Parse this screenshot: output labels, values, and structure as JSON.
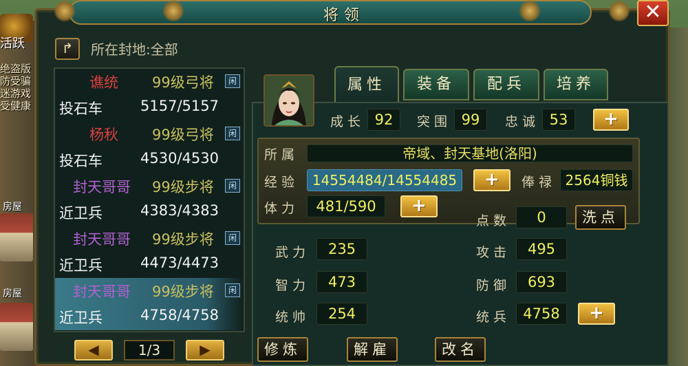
{
  "window": {
    "title": "将领",
    "close_label": "✕"
  },
  "fief": {
    "label": "所在封地:全部"
  },
  "left_side": {
    "tag": "活跃",
    "promo_lines": [
      "绝盗版",
      "防受骗",
      "迷游戏",
      "受健康"
    ],
    "houses": [
      "房屋",
      "房屋"
    ]
  },
  "generals": [
    {
      "name": "谯统",
      "name_color": "#d84040",
      "level": "99级弓将",
      "tag": "闲",
      "troop": "投石车",
      "count": "5157/5157"
    },
    {
      "name": "杨秋",
      "name_color": "#d84040",
      "level": "99级弓将",
      "tag": "闲",
      "troop": "投石车",
      "count": "4530/4530"
    },
    {
      "name": "封天哥哥",
      "name_color": "#b060d0",
      "level": "99级步将",
      "tag": "闲",
      "troop": "近卫兵",
      "count": "4383/4383"
    },
    {
      "name": "封天哥哥",
      "name_color": "#b060d0",
      "level": "99级步将",
      "tag": "闲",
      "troop": "近卫兵",
      "count": "4473/4473"
    },
    {
      "name": "封天哥哥",
      "name_color": "#b060d0",
      "level": "99级步将",
      "tag": "闲",
      "troop": "近卫兵",
      "count": "4758/4758"
    }
  ],
  "pagination": {
    "prev": "◀",
    "page": "1/3",
    "next": "▶"
  },
  "tabs": [
    "属性",
    "装备",
    "配兵",
    "培养"
  ],
  "top_stats": {
    "growth_label": "成长",
    "growth": "92",
    "breakthrough_label": "突围",
    "breakthrough": "99",
    "loyalty_label": "忠诚",
    "loyalty": "53"
  },
  "info": {
    "belong_label": "所属",
    "belong": "帝域、封天基地(洛阳)",
    "exp_label": "经验",
    "exp": "14554484/14554485",
    "salary_label": "俸禄",
    "salary": "2564铜钱",
    "stamina_label": "体力",
    "stamina": "481/590"
  },
  "points": {
    "label": "点数",
    "value": "0",
    "reset": "洗点"
  },
  "attributes": {
    "force_label": "武力",
    "force": "235",
    "intel_label": "智力",
    "intel": "473",
    "command_label": "统帅",
    "command": "254",
    "attack_label": "攻击",
    "attack": "495",
    "defense_label": "防御",
    "defense": "693",
    "troops_label": "统兵",
    "troops": "4758"
  },
  "actions": {
    "train": "修炼",
    "dismiss": "解雇",
    "rename": "改名"
  },
  "plus": "+"
}
